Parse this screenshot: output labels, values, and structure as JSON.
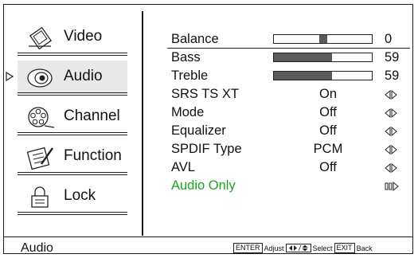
{
  "sidebar": {
    "items": [
      {
        "label": "Video",
        "icon": "tv-icon"
      },
      {
        "label": "Audio",
        "icon": "speaker-icon",
        "selected": true
      },
      {
        "label": "Channel",
        "icon": "film-reel-icon"
      },
      {
        "label": "Function",
        "icon": "notepad-pencil-icon"
      },
      {
        "label": "Lock",
        "icon": "lock-icon"
      }
    ]
  },
  "audio": {
    "balance": {
      "label": "Balance",
      "value": "0",
      "level": 0.5
    },
    "bass": {
      "label": "Bass",
      "value": "59",
      "level": 0.59
    },
    "treble": {
      "label": "Treble",
      "value": "59",
      "level": 0.59
    },
    "srs": {
      "label": "SRS TS XT",
      "value": "On"
    },
    "mode": {
      "label": "Mode",
      "value": "Off"
    },
    "equalizer": {
      "label": "Equalizer",
      "value": "Off"
    },
    "spdif": {
      "label": "SPDIF Type",
      "value": "PCM"
    },
    "avl": {
      "label": "AVL",
      "value": "Off"
    },
    "audio_only": {
      "label": "Audio Only"
    }
  },
  "status": {
    "title": "Audio",
    "enter_key": "ENTER",
    "adjust_label": "Adjust",
    "select_label": "Select",
    "exit_key": "EXIT",
    "back_label": "Back"
  },
  "colors": {
    "accent": "#19a519",
    "bar_fill": "#5a5a5a"
  }
}
